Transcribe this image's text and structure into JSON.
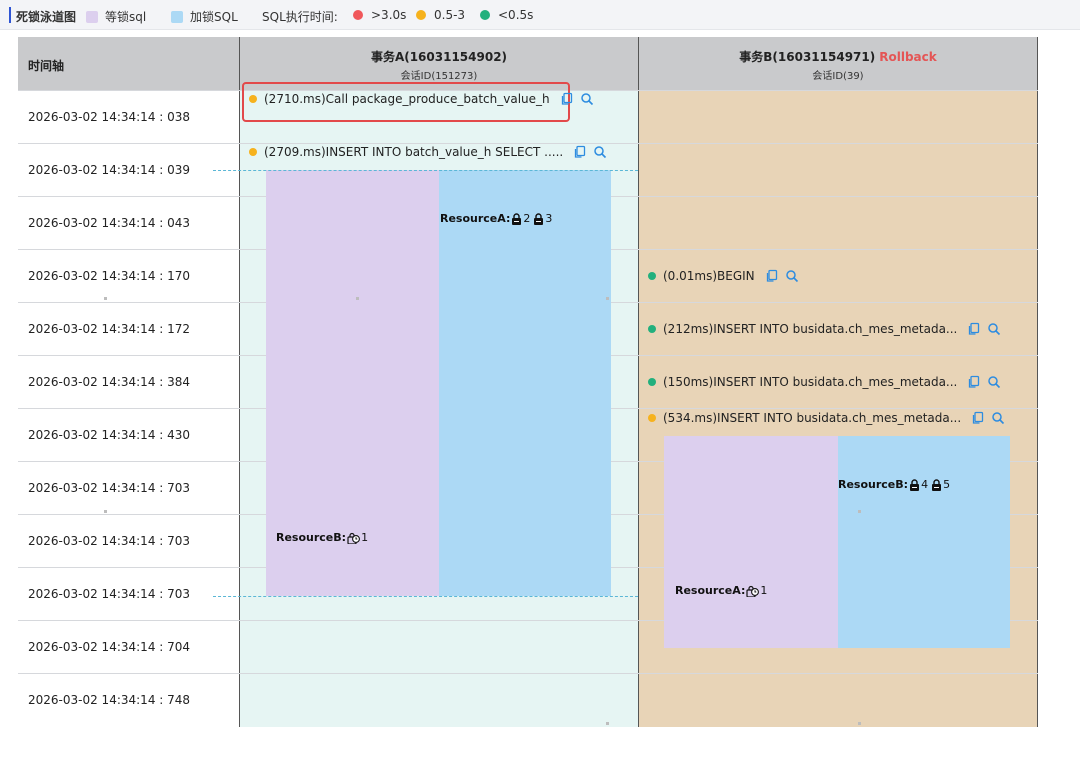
{
  "legend": {
    "title": "死锁泳道图",
    "wait_sql": "等锁sql",
    "lock_sql": "加锁SQL",
    "exec_time_label": "SQL执行时间:",
    "slow": ">3.0s",
    "medium": "0.5-3",
    "fast": "<0.5s",
    "colors": {
      "wait": "#dccfee",
      "lock": "#acd9f5",
      "slow": "#f0575b",
      "medium": "#f6b21d",
      "fast": "#22b07d"
    }
  },
  "header": {
    "time_axis": "时间轴",
    "trx_a": {
      "title": "事务A(16031154902)",
      "session": "会话ID(151273)"
    },
    "trx_b": {
      "title": "事务B(16031154971)",
      "rollback": "Rollback",
      "session": "会话ID(39)"
    }
  },
  "times": [
    "2026-03-02 14:34:14 : 038",
    "2026-03-02 14:34:14 : 039",
    "2026-03-02 14:34:14 : 043",
    "2026-03-02 14:34:14 : 170",
    "2026-03-02 14:34:14 : 172",
    "2026-03-02 14:34:14 : 384",
    "2026-03-02 14:34:14 : 430",
    "2026-03-02 14:34:14 : 703",
    "2026-03-02 14:34:14 : 703",
    "2026-03-02 14:34:14 : 703",
    "2026-03-02 14:34:14 : 704",
    "2026-03-02 14:34:14 : 748"
  ],
  "trx_a_sqls": [
    {
      "text": "(2710.ms)Call package_produce_batch_value_h",
      "level": "medium"
    },
    {
      "text": "(2709.ms)INSERT INTO batch_value_h SELECT .....",
      "level": "medium"
    }
  ],
  "trx_b_sqls": [
    {
      "text": "(0.01ms)BEGIN",
      "level": "fast"
    },
    {
      "text": "(212ms)INSERT INTO busidata.ch_mes_metada...",
      "level": "fast"
    },
    {
      "text": "(150ms)INSERT INTO busidata.ch_mes_metada...",
      "level": "fast"
    },
    {
      "text": "(534.ms)INSERT INTO busidata.ch_mes_metada...",
      "level": "medium"
    }
  ],
  "locks": {
    "a_held": {
      "label": "ResourceA:",
      "ids": [
        "2",
        "3"
      ]
    },
    "a_wait": {
      "label": "ResourceB:",
      "ids": [
        "1"
      ]
    },
    "b_held": {
      "label": "ResourceB:",
      "ids": [
        "4",
        "5"
      ]
    },
    "b_wait": {
      "label": "ResourceA:",
      "ids": [
        "1"
      ]
    }
  }
}
